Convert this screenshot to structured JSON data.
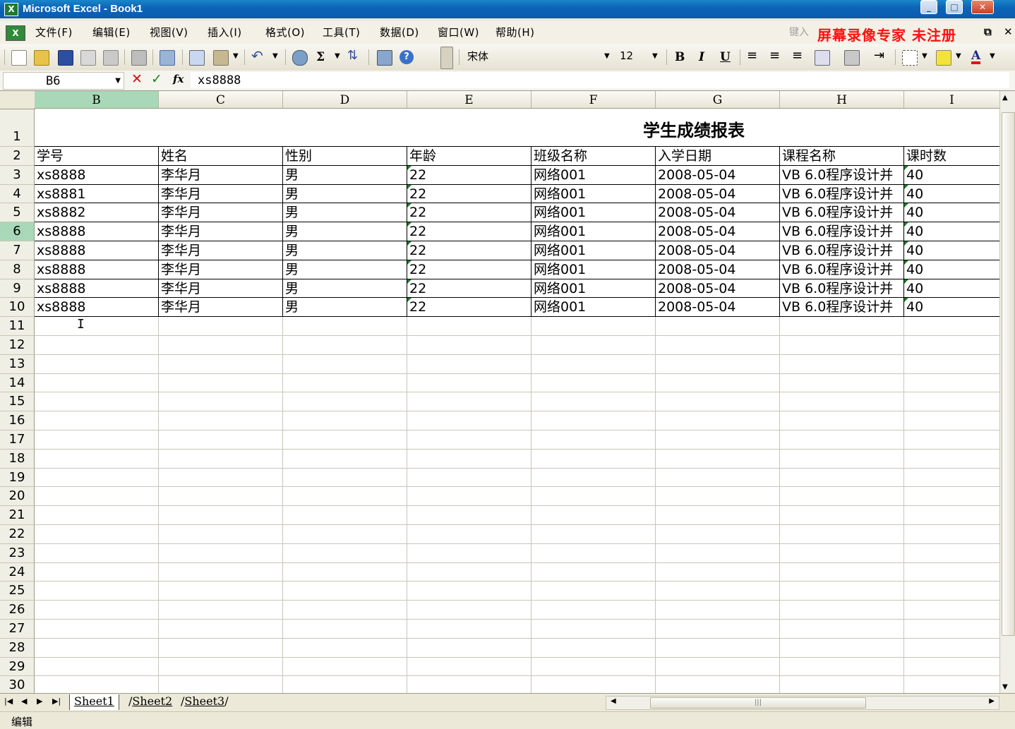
{
  "window": {
    "title": "Microsoft Excel - Book1",
    "app_icon": "X"
  },
  "menu": {
    "items": [
      "文件(F)",
      "编辑(E)",
      "视图(V)",
      "插入(I)",
      "格式(O)",
      "工具(T)",
      "数据(D)",
      "窗口(W)",
      "帮助(H)"
    ],
    "help_placeholder": "键入",
    "watermark": "屏幕录像专家  未注册"
  },
  "toolbar": {
    "font_name": "宋体",
    "font_size": "12",
    "bold": "B",
    "italic": "I",
    "underline": "U",
    "sum": "Σ"
  },
  "formula_bar": {
    "name_box": "B6",
    "content": "xs8888"
  },
  "sheet": {
    "columns": [
      "B",
      "C",
      "D",
      "E",
      "F",
      "G",
      "H",
      "I"
    ],
    "selected_column": "B",
    "selected_row": "6",
    "title": "学生成绩报表",
    "header": [
      "学号",
      "姓名",
      "性别",
      "年龄",
      "班级名称",
      "入学日期",
      "课程名称",
      "课时数"
    ],
    "rows": [
      [
        "xs8888",
        "李华月",
        "男",
        "22",
        "网络001",
        "2008-05-04",
        "VB 6.0程序设计并",
        "40"
      ],
      [
        "xs8881",
        "李华月",
        "男",
        "22",
        "网络001",
        "2008-05-04",
        "VB 6.0程序设计并",
        "40"
      ],
      [
        "xs8882",
        "李华月",
        "男",
        "22",
        "网络001",
        "2008-05-04",
        "VB 6.0程序设计并",
        "40"
      ],
      [
        "xs8888",
        "李华月",
        "男",
        "22",
        "网络001",
        "2008-05-04",
        "VB 6.0程序设计并",
        "40"
      ],
      [
        "xs8888",
        "李华月",
        "男",
        "22",
        "网络001",
        "2008-05-04",
        "VB 6.0程序设计并",
        "40"
      ],
      [
        "xs8888",
        "李华月",
        "男",
        "22",
        "网络001",
        "2008-05-04",
        "VB 6.0程序设计并",
        "40"
      ],
      [
        "xs8888",
        "李华月",
        "男",
        "22",
        "网络001",
        "2008-05-04",
        "VB 6.0程序设计并",
        "40"
      ],
      [
        "xs8888",
        "李华月",
        "男",
        "22",
        "网络001",
        "2008-05-04",
        "VB 6.0程序设计并",
        "40"
      ]
    ],
    "row_numbers": [
      "1",
      "2",
      "3",
      "4",
      "5",
      "6",
      "7",
      "8",
      "9",
      "10",
      "11",
      "12",
      "13",
      "14",
      "15",
      "16",
      "17",
      "18",
      "19",
      "20",
      "21",
      "22",
      "23",
      "24",
      "25",
      "26",
      "27",
      "28",
      "29",
      "30"
    ]
  },
  "tabs": [
    "Sheet1",
    "Sheet2",
    "Sheet3"
  ],
  "status": {
    "mode": "编辑"
  }
}
